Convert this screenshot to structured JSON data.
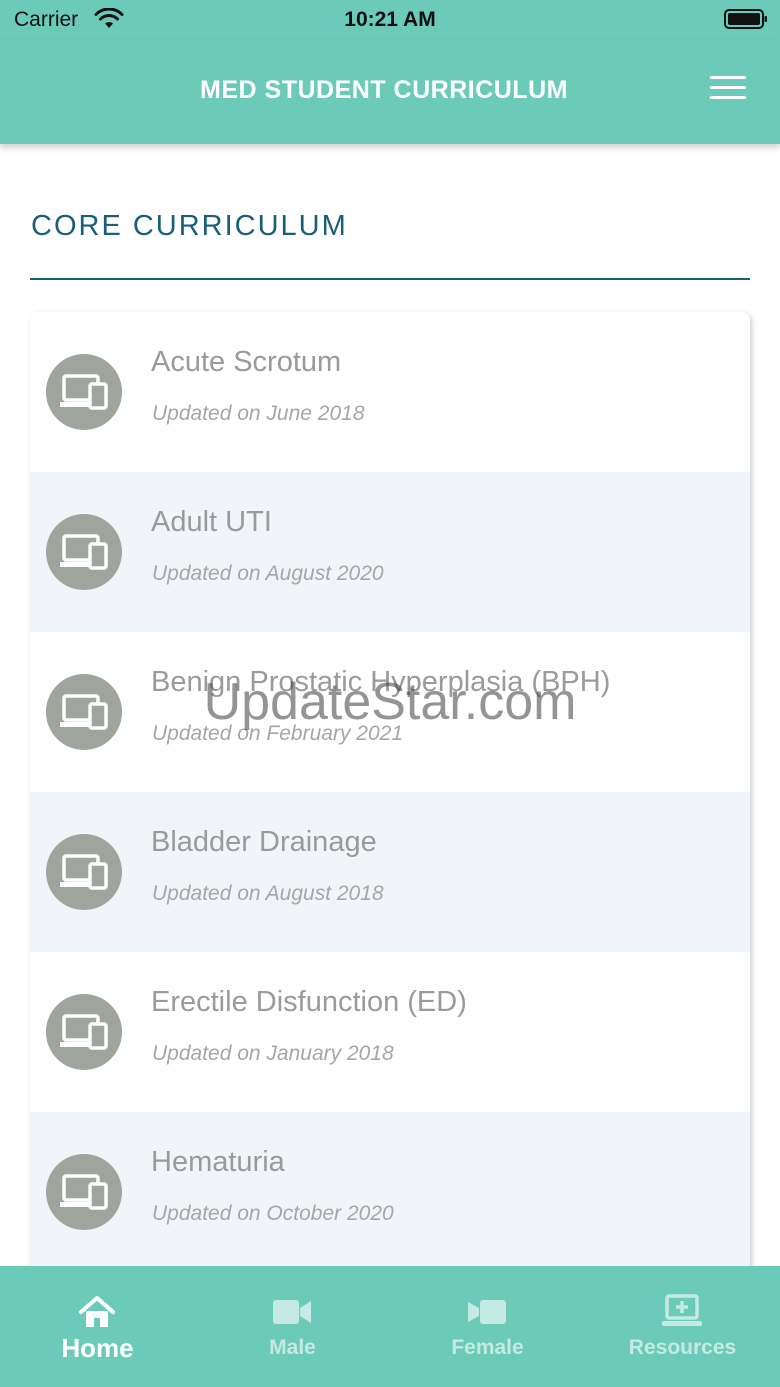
{
  "status_bar": {
    "carrier": "Carrier",
    "time": "10:21 AM"
  },
  "header": {
    "title": "MED STUDENT CURRICULUM",
    "menu_icon": "hamburger-menu-icon"
  },
  "section": {
    "title": "CORE CURRICULUM"
  },
  "items": [
    {
      "title": "Acute Scrotum",
      "subtitle": "Updated on June 2018",
      "icon": "devices-icon"
    },
    {
      "title": "Adult UTI",
      "subtitle": "Updated on August 2020",
      "icon": "devices-icon"
    },
    {
      "title": "Benign Prostatic Hyperplasia (BPH)",
      "subtitle": "Updated on February 2021",
      "icon": "devices-icon"
    },
    {
      "title": "Bladder Drainage",
      "subtitle": "Updated on August 2018",
      "icon": "devices-icon"
    },
    {
      "title": "Erectile Disfunction (ED)",
      "subtitle": "Updated on January 2018",
      "icon": "devices-icon"
    },
    {
      "title": "Hematuria",
      "subtitle": "Updated on October 2020",
      "icon": "devices-icon"
    }
  ],
  "watermark": "UpdateStar.com",
  "tabs": [
    {
      "label": "Home",
      "icon": "home-icon",
      "active": true
    },
    {
      "label": "Male",
      "icon": "video-camera-icon",
      "active": false
    },
    {
      "label": "Female",
      "icon": "film-icon",
      "active": false
    },
    {
      "label": "Resources",
      "icon": "laptop-medical-icon",
      "active": false
    }
  ],
  "colors": {
    "brand": "#6ccab8",
    "section_title": "#1a5f7a",
    "icon_circle": "#9fa49d",
    "row_alt_bg": "#f1f4f8"
  }
}
